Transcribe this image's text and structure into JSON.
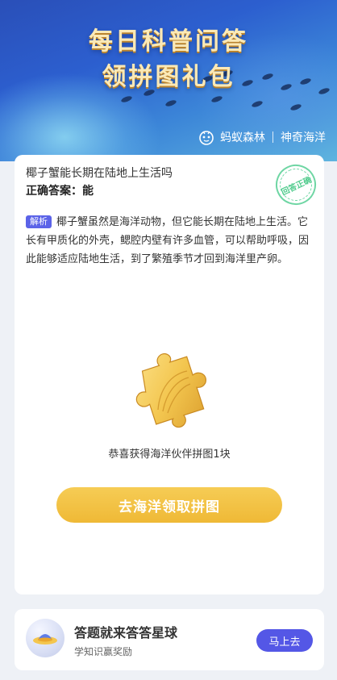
{
  "banner": {
    "title_line1": "每日科普问答",
    "title_line2": "领拼图礼包",
    "brand_name": "蚂蚁森林",
    "brand_partner": "神奇海洋"
  },
  "quiz": {
    "question": "椰子蟹能长期在陆地上生活吗",
    "answer": "正确答案：能",
    "stamp_text": "回答正确",
    "explain_tag": "解析",
    "explanation": "椰子蟹虽然是海洋动物，但它能长期在陆地上生活。它长有甲质化的外壳，鳃腔内壁有许多血管，可以帮助呼吸，因此能够适应陆地生活，到了繁殖季节才回到海洋里产卵。",
    "reward_text": "恭喜获得海洋伙伴拼图1块",
    "cta_label": "去海洋领取拼图"
  },
  "promo": {
    "title": "答题就来答答星球",
    "subtitle": "学知识赢奖励",
    "button_label": "马上去"
  },
  "colors": {
    "accent_purple": "#5457e6",
    "cta_gold": "#f2c144",
    "stamp_green": "#4fcb8c"
  }
}
